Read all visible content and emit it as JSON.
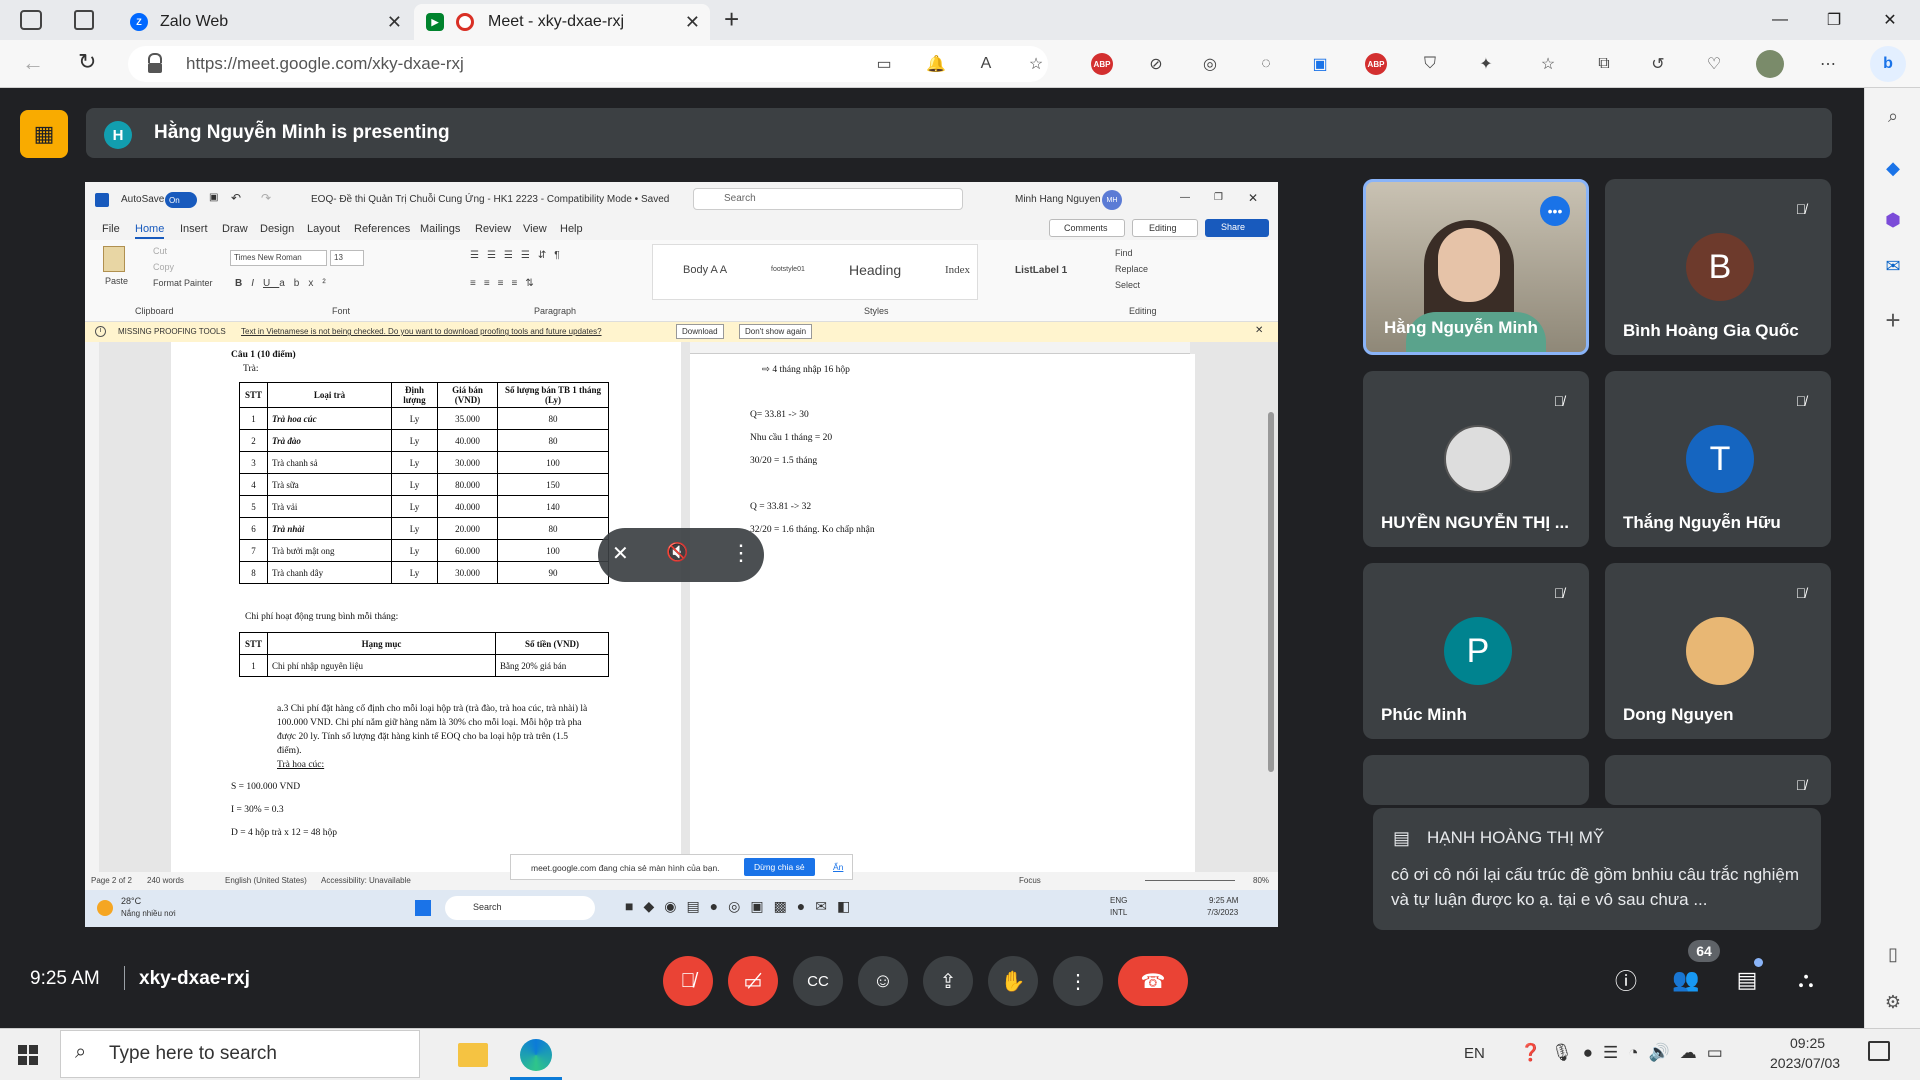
{
  "browser": {
    "tabs": [
      {
        "title": "Zalo Web",
        "favicon": "zalo-icon"
      },
      {
        "title": "Meet - xky-dxae-rxj",
        "favicon": "meet-icon"
      }
    ],
    "url": "https://meet.google.com/xky-dxae-rxj"
  },
  "meet": {
    "presenter_initial": "H",
    "presenting_text": "Hằng Nguyễn Minh is presenting",
    "time": "9:25 AM",
    "meeting_code": "xky-dxae-rxj",
    "participant_count": "64",
    "tiles": [
      {
        "name": "Hằng Nguyễn Minh",
        "type": "video"
      },
      {
        "name": "Bình Hoàng Gia Quốc",
        "initial": "B",
        "color": "#6d3a2c"
      },
      {
        "name": "HUYỀN NGUYỄN THỊ ...",
        "type": "photo-cat"
      },
      {
        "name": "Thắng Nguyễn Hữu",
        "initial": "T",
        "color": "#1565c0"
      },
      {
        "name": "Phúc Minh",
        "initial": "P",
        "color": "#00838f"
      },
      {
        "name": "Dong Nguyen",
        "type": "photo-cat2"
      }
    ],
    "chat": {
      "sender": "HẠNH HOÀNG THỊ MỸ",
      "message": "cô ơi cô nói lại cấu trúc đề gồm bnhiu câu trắc nghiệm và tự luận được ko ạ. tại e vô sau chưa ..."
    }
  },
  "word": {
    "autosave": "AutoSave",
    "autosave_state": "On",
    "doc_title": "EOQ- Đề thi Quản Trị Chuỗi Cung Ứng - HK1 2223  -  Compatibility Mode • Saved",
    "search": "Search",
    "user": "Minh Hang Nguyen",
    "user_initials": "MH",
    "menu": [
      "File",
      "Home",
      "Insert",
      "Draw",
      "Design",
      "Layout",
      "References",
      "Mailings",
      "Review",
      "View",
      "Help"
    ],
    "comments": "Comments",
    "editing": "Editing",
    "share": "Share",
    "font": "Times New Roman",
    "font_size": "13",
    "clipboard": {
      "paste": "Paste",
      "cut": "Cut",
      "copy": "Copy",
      "format_painter": "Format Painter",
      "label": "Clipboard"
    },
    "group_labels": {
      "font": "Font",
      "paragraph": "Paragraph",
      "styles": "Styles",
      "editing": "Editing"
    },
    "styles": [
      "Body A A",
      "footstyle01",
      "Heading",
      "Index",
      "ListLabel 1"
    ],
    "editing_items": [
      "Find",
      "Replace",
      "Select"
    ],
    "msg": {
      "title": "MISSING PROOFING TOOLS",
      "text": "Text in Vietnamese is not being checked. Do you want to download proofing tools and future updates?",
      "download": "Download",
      "dont_show": "Don't show again"
    },
    "status": {
      "page": "Page 2 of 2",
      "words": "240 words",
      "lang": "English (United States)",
      "access": "Accessibility: Unavailable",
      "focus": "Focus",
      "zoom": "80%"
    }
  },
  "doc": {
    "heading": "Câu 1  (10 điểm)",
    "sub": "Trà:",
    "table1_headers": [
      "STT",
      "Loại trà",
      "Định lượng",
      "Giá bán (VND)",
      "Số lượng bán TB 1 tháng (Ly)"
    ],
    "table1_rows": [
      [
        "1",
        "Trà hoa cúc",
        "Ly",
        "35.000",
        "80"
      ],
      [
        "2",
        "Trà đào",
        "Ly",
        "40.000",
        "80"
      ],
      [
        "3",
        "Trà chanh sả",
        "Ly",
        "30.000",
        "100"
      ],
      [
        "4",
        "Trà sữa",
        "Ly",
        "80.000",
        "150"
      ],
      [
        "5",
        "Trà vải",
        "Ly",
        "40.000",
        "140"
      ],
      [
        "6",
        "Trà nhài",
        "Ly",
        "20.000",
        "80"
      ],
      [
        "7",
        "Trà bưởi mật ong",
        "Ly",
        "60.000",
        "100"
      ],
      [
        "8",
        "Trà chanh dây",
        "Ly",
        "30.000",
        "90"
      ]
    ],
    "cost_title": "Chi phí hoạt động trung bình mỗi tháng:",
    "table2_headers": [
      "STT",
      "Hạng mục",
      "Số tiền (VND)"
    ],
    "table2_rows": [
      [
        "1",
        "Chi phí nhập nguyên liệu",
        "Bằng 20% giá bán"
      ]
    ],
    "para": [
      "a.3 Chi phí đặt hàng cố định cho mỗi loại hộp trà (trà đào, trà hoa cúc, trà nhài) là",
      "100.000 VND. Chi phí nắm giữ hàng năm là 30% cho mỗi loại. Mỗi hộp trà pha",
      "được 20 ly. Tính số lượng đặt hàng kinh tế EOQ cho ba loại hộp trà trên (1.5",
      "điểm)."
    ],
    "tra_hoa_cuc": "Trà hoa cúc:",
    "s_line": "S = 100.000 VND",
    "i_line": "I = 30% = 0.3",
    "d_line": "D = 4 hộp trà x 12 = 48 hộp",
    "right_lines": [
      "⇨  4 tháng nhập 16 hộp",
      "Q= 33.81 -> 30",
      "Nhu cầu 1 tháng = 20",
      "30/20 = 1.5 tháng",
      "Q = 33.81 -> 32",
      "32/20 = 1.6 tháng. Ko chấp nhận"
    ]
  },
  "share_note": {
    "text": "meet.google.com đang chia sẻ màn hình của bạn.",
    "stop": "Dừng chia sẻ",
    "hide": "Ẩn"
  },
  "inner_taskbar": {
    "temp": "28°C",
    "weather": "Nắng nhiều nơi",
    "search": "Search",
    "lang1": "ENG",
    "lang2": "INTL",
    "time": "9:25 AM",
    "date": "7/3/2023"
  },
  "windows": {
    "search_placeholder": "Type here to search",
    "lang": "EN",
    "time": "09:25",
    "date": "2023/07/03"
  }
}
